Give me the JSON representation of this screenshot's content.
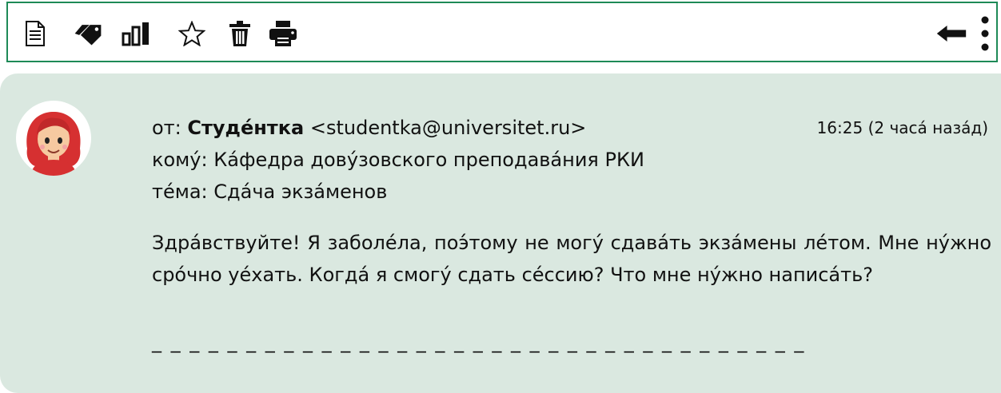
{
  "toolbar": {
    "icons": [
      {
        "name": "document-icon"
      },
      {
        "name": "tag-icon"
      },
      {
        "name": "bar-chart-icon"
      },
      {
        "name": "star-icon"
      },
      {
        "name": "trash-icon"
      },
      {
        "name": "print-icon"
      },
      {
        "name": "back-arrow-icon"
      },
      {
        "name": "more-vertical-icon"
      }
    ],
    "accent_color": "#1e8a57"
  },
  "email": {
    "from_prefix": "от: ",
    "from_name": "Студе́нтка",
    "from_address": "<studentka@universitet.ru>",
    "time": "16:25 (2 часа́ наза́д)",
    "to_prefix": "кому́: ",
    "to": "Ка́федра дову́зовского преподава́ния РКИ",
    "subject_prefix": "те́ма: ",
    "subject": "Сда́ча экза́менов",
    "body": "Здра́вствуйте! Я заболе́ла, поэ́тому не могу́ сдава́ть экза́мены ле́том. Мне ну́жно сро́чно уе́хать. Когда́ я смогу́ сдать се́ссию? Что мне ну́жно написа́ть?",
    "answer_placeholder": "_ _ _ _ _ _ _ _ _ _ _ _ _ _ _ _ _ _ _ _ _ _ _ _ _ _ _ _ _ _ _ _ _ _ _"
  },
  "colors": {
    "panel_background": "#dae8e0",
    "avatar_hair": "#d63031"
  }
}
